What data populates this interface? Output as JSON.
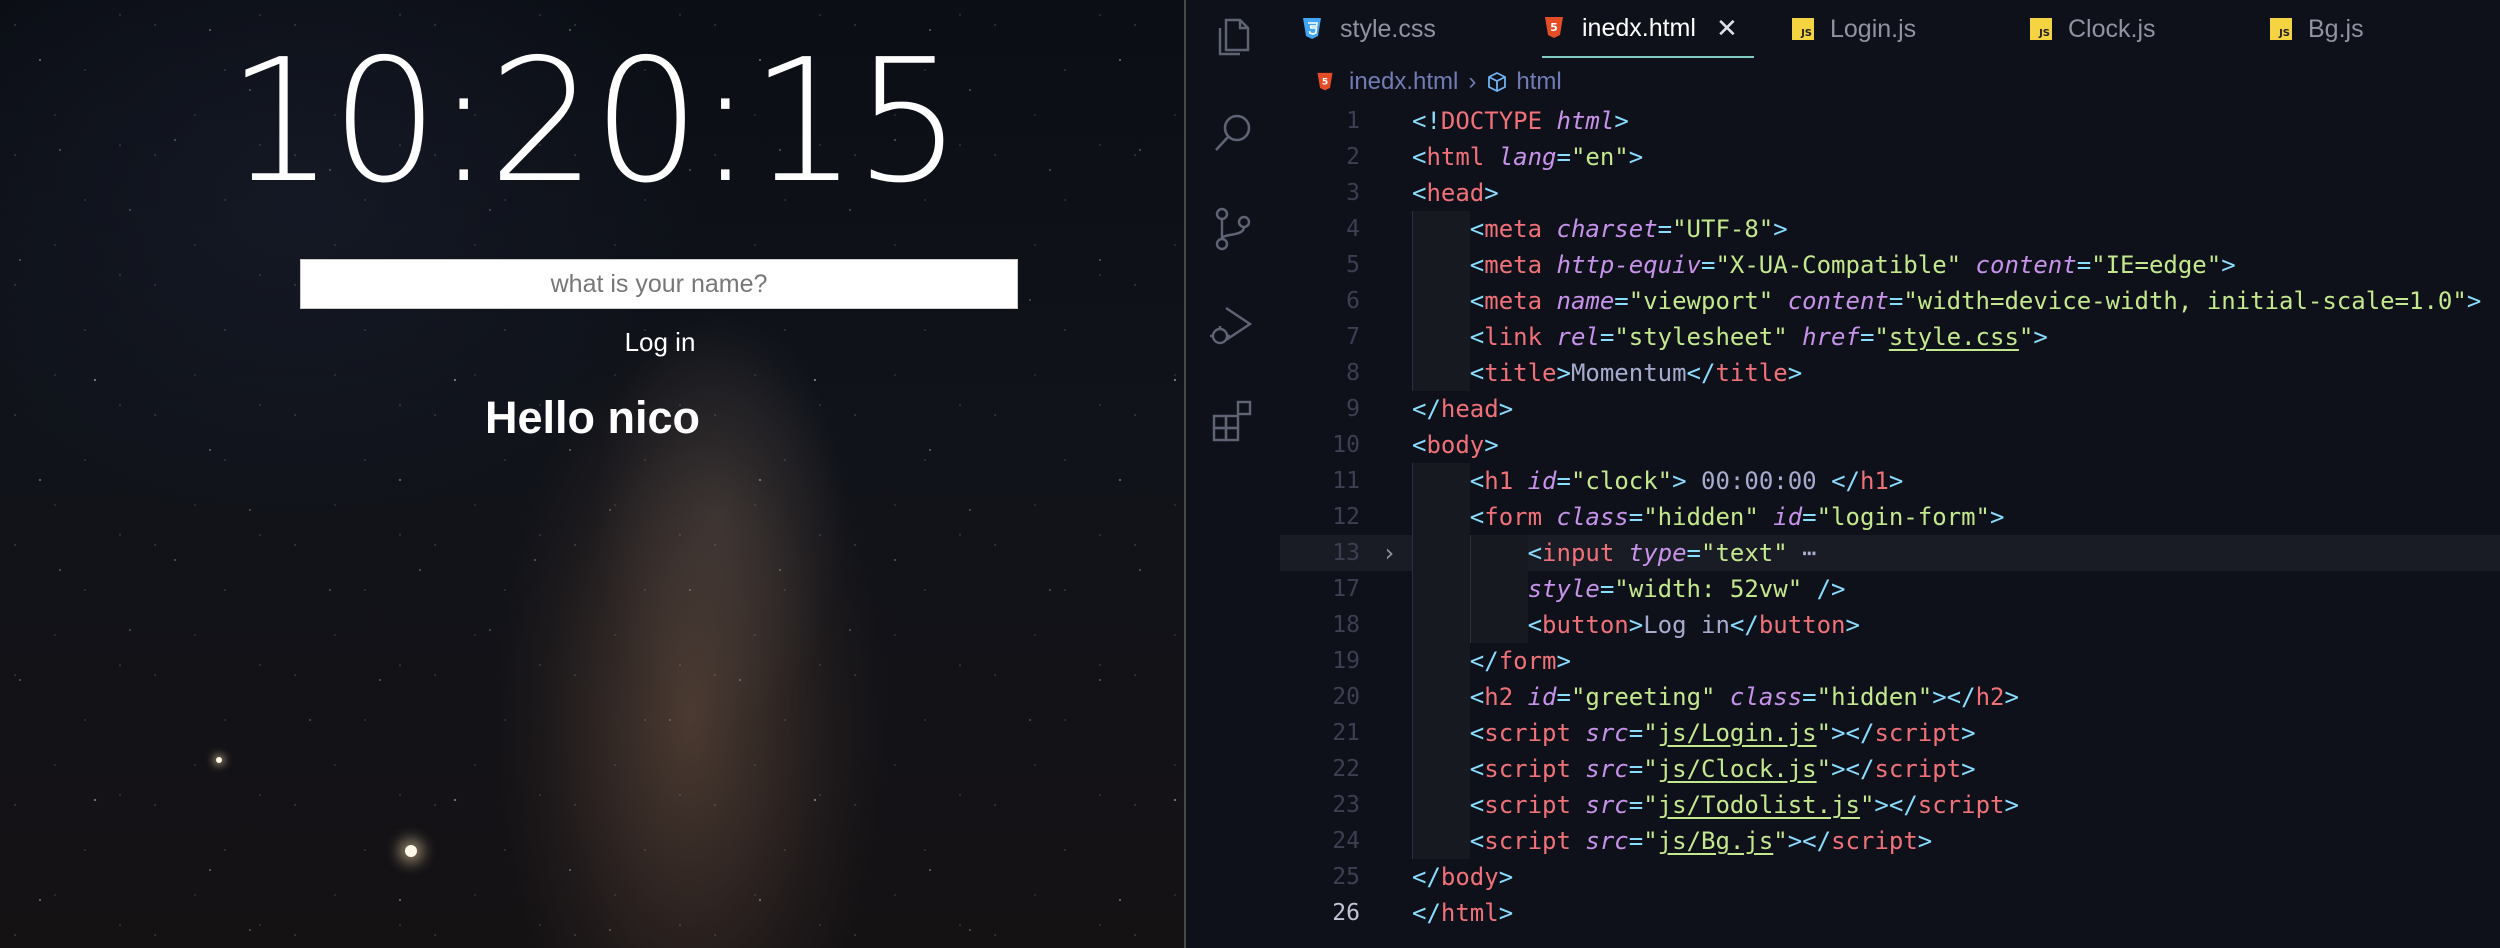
{
  "preview": {
    "clock": "10:20:15",
    "input_placeholder": "what is your name?",
    "login_button": "Log in",
    "greeting": "Hello nico"
  },
  "activity_bar": {
    "icons": [
      "files-icon",
      "search-icon",
      "source-control-icon",
      "run-debug-icon",
      "extensions-icon"
    ]
  },
  "tabs": [
    {
      "label": "style.css",
      "icon": "css-icon",
      "active": false
    },
    {
      "label": "inedx.html",
      "icon": "html-icon",
      "active": true
    },
    {
      "label": "Login.js",
      "icon": "js-icon",
      "active": false
    },
    {
      "label": "Clock.js",
      "icon": "js-icon",
      "active": false
    },
    {
      "label": "Bg.js",
      "icon": "js-icon",
      "active": false
    }
  ],
  "js_badge": "JS",
  "breadcrumb": {
    "file": "inedx.html",
    "symbol": "html"
  },
  "code": {
    "lines": [
      {
        "n": "1",
        "tokens": [
          [
            "br",
            "<!"
          ],
          [
            "tag",
            "DOCTYPE"
          ],
          [
            "txt",
            " "
          ],
          [
            "attr",
            "html"
          ],
          [
            "br",
            ">"
          ]
        ]
      },
      {
        "n": "2",
        "tokens": [
          [
            "br",
            "<"
          ],
          [
            "tag",
            "html"
          ],
          [
            "txt",
            " "
          ],
          [
            "attr",
            "lang"
          ],
          [
            "br",
            "="
          ],
          [
            "str",
            "\"en\""
          ],
          [
            "br",
            ">"
          ]
        ]
      },
      {
        "n": "3",
        "tokens": [
          [
            "br",
            "<"
          ],
          [
            "tag",
            "head"
          ],
          [
            "br",
            ">"
          ]
        ]
      },
      {
        "n": "4",
        "tokens": [
          [
            "br",
            "<"
          ],
          [
            "tag",
            "meta"
          ],
          [
            "txt",
            " "
          ],
          [
            "attr",
            "charset"
          ],
          [
            "br",
            "="
          ],
          [
            "str",
            "\"UTF-8\""
          ],
          [
            "br",
            ">"
          ]
        ]
      },
      {
        "n": "5",
        "tokens": [
          [
            "br",
            "<"
          ],
          [
            "tag",
            "meta"
          ],
          [
            "txt",
            " "
          ],
          [
            "attr",
            "http-equiv"
          ],
          [
            "br",
            "="
          ],
          [
            "str",
            "\"X-UA-Compatible\""
          ],
          [
            "txt",
            " "
          ],
          [
            "attr",
            "content"
          ],
          [
            "br",
            "="
          ],
          [
            "str",
            "\"IE=edge\""
          ],
          [
            "br",
            ">"
          ]
        ]
      },
      {
        "n": "6",
        "tokens": [
          [
            "br",
            "<"
          ],
          [
            "tag",
            "meta"
          ],
          [
            "txt",
            " "
          ],
          [
            "attr",
            "name"
          ],
          [
            "br",
            "="
          ],
          [
            "str",
            "\"viewport\""
          ],
          [
            "txt",
            " "
          ],
          [
            "attr",
            "content"
          ],
          [
            "br",
            "="
          ],
          [
            "str",
            "\"width=device-width, initial-scale=1.0\""
          ],
          [
            "br",
            ">"
          ]
        ]
      },
      {
        "n": "7",
        "tokens": [
          [
            "br",
            "<"
          ],
          [
            "tag",
            "link"
          ],
          [
            "txt",
            " "
          ],
          [
            "attr",
            "rel"
          ],
          [
            "br",
            "="
          ],
          [
            "str",
            "\"stylesheet\""
          ],
          [
            "txt",
            " "
          ],
          [
            "attr",
            "href"
          ],
          [
            "br",
            "="
          ],
          [
            "str",
            "\""
          ],
          [
            "stru",
            "style.css"
          ],
          [
            "str",
            "\""
          ],
          [
            "br",
            ">"
          ]
        ]
      },
      {
        "n": "8",
        "tokens": [
          [
            "br",
            "<"
          ],
          [
            "tag",
            "title"
          ],
          [
            "br",
            ">"
          ],
          [
            "txt",
            "Momentum"
          ],
          [
            "br",
            "</"
          ],
          [
            "tag",
            "title"
          ],
          [
            "br",
            ">"
          ]
        ]
      },
      {
        "n": "9",
        "tokens": [
          [
            "br",
            "</"
          ],
          [
            "tag",
            "head"
          ],
          [
            "br",
            ">"
          ]
        ]
      },
      {
        "n": "10",
        "tokens": [
          [
            "br",
            "<"
          ],
          [
            "tag",
            "body"
          ],
          [
            "br",
            ">"
          ]
        ]
      },
      {
        "n": "11",
        "tokens": [
          [
            "br",
            "<"
          ],
          [
            "tag",
            "h1"
          ],
          [
            "txt",
            " "
          ],
          [
            "attr",
            "id"
          ],
          [
            "br",
            "="
          ],
          [
            "str",
            "\"clock\""
          ],
          [
            "br",
            ">"
          ],
          [
            "txt",
            " 00:00:00 "
          ],
          [
            "br",
            "</"
          ],
          [
            "tag",
            "h1"
          ],
          [
            "br",
            ">"
          ]
        ]
      },
      {
        "n": "12",
        "tokens": [
          [
            "br",
            "<"
          ],
          [
            "tag",
            "form"
          ],
          [
            "txt",
            " "
          ],
          [
            "attr",
            "class"
          ],
          [
            "br",
            "="
          ],
          [
            "str",
            "\"hidden\""
          ],
          [
            "txt",
            " "
          ],
          [
            "attr",
            "id"
          ],
          [
            "br",
            "="
          ],
          [
            "str",
            "\"login-form\""
          ],
          [
            "br",
            ">"
          ]
        ]
      },
      {
        "n": "13",
        "tokens": [
          [
            "br",
            "<"
          ],
          [
            "tag",
            "input"
          ],
          [
            "txt",
            " "
          ],
          [
            "attr",
            "type"
          ],
          [
            "br",
            "="
          ],
          [
            "str",
            "\"text\""
          ],
          [
            "txt",
            " "
          ],
          [
            "dots",
            "⋯"
          ]
        ]
      },
      {
        "n": "17",
        "tokens": [
          [
            "attr",
            "style"
          ],
          [
            "br",
            "="
          ],
          [
            "str",
            "\"width: 52vw\""
          ],
          [
            "txt",
            " "
          ],
          [
            "br",
            "/>"
          ]
        ]
      },
      {
        "n": "18",
        "tokens": [
          [
            "br",
            "<"
          ],
          [
            "tag",
            "button"
          ],
          [
            "br",
            ">"
          ],
          [
            "txt",
            "Log in"
          ],
          [
            "br",
            "</"
          ],
          [
            "tag",
            "button"
          ],
          [
            "br",
            ">"
          ]
        ]
      },
      {
        "n": "19",
        "tokens": [
          [
            "br",
            "</"
          ],
          [
            "tag",
            "form"
          ],
          [
            "br",
            ">"
          ]
        ]
      },
      {
        "n": "20",
        "tokens": [
          [
            "br",
            "<"
          ],
          [
            "tag",
            "h2"
          ],
          [
            "txt",
            " "
          ],
          [
            "attr",
            "id"
          ],
          [
            "br",
            "="
          ],
          [
            "str",
            "\"greeting\""
          ],
          [
            "txt",
            " "
          ],
          [
            "attr",
            "class"
          ],
          [
            "br",
            "="
          ],
          [
            "str",
            "\"hidden\""
          ],
          [
            "br",
            "></"
          ],
          [
            "tag",
            "h2"
          ],
          [
            "br",
            ">"
          ]
        ]
      },
      {
        "n": "21",
        "tokens": [
          [
            "br",
            "<"
          ],
          [
            "tag",
            "script"
          ],
          [
            "txt",
            " "
          ],
          [
            "attr",
            "src"
          ],
          [
            "br",
            "="
          ],
          [
            "str",
            "\""
          ],
          [
            "stru",
            "js/Login.js"
          ],
          [
            "str",
            "\""
          ],
          [
            "br",
            "></"
          ],
          [
            "tag",
            "script"
          ],
          [
            "br",
            ">"
          ]
        ]
      },
      {
        "n": "22",
        "tokens": [
          [
            "br",
            "<"
          ],
          [
            "tag",
            "script"
          ],
          [
            "txt",
            " "
          ],
          [
            "attr",
            "src"
          ],
          [
            "br",
            "="
          ],
          [
            "str",
            "\""
          ],
          [
            "stru",
            "js/Clock.js"
          ],
          [
            "str",
            "\""
          ],
          [
            "br",
            "></"
          ],
          [
            "tag",
            "script"
          ],
          [
            "br",
            ">"
          ]
        ]
      },
      {
        "n": "23",
        "tokens": [
          [
            "br",
            "<"
          ],
          [
            "tag",
            "script"
          ],
          [
            "txt",
            " "
          ],
          [
            "attr",
            "src"
          ],
          [
            "br",
            "="
          ],
          [
            "str",
            "\""
          ],
          [
            "stru",
            "js/Todolist.js"
          ],
          [
            "str",
            "\""
          ],
          [
            "br",
            "></"
          ],
          [
            "tag",
            "script"
          ],
          [
            "br",
            ">"
          ]
        ]
      },
      {
        "n": "24",
        "tokens": [
          [
            "br",
            "<"
          ],
          [
            "tag",
            "script"
          ],
          [
            "txt",
            " "
          ],
          [
            "attr",
            "src"
          ],
          [
            "br",
            "="
          ],
          [
            "str",
            "\""
          ],
          [
            "stru",
            "js/Bg.js"
          ],
          [
            "str",
            "\""
          ],
          [
            "br",
            "></"
          ],
          [
            "tag",
            "script"
          ],
          [
            "br",
            ">"
          ]
        ]
      },
      {
        "n": "25",
        "tokens": [
          [
            "br",
            "</"
          ],
          [
            "tag",
            "body"
          ],
          [
            "br",
            ">"
          ]
        ]
      },
      {
        "n": "26",
        "tokens": [
          [
            "br",
            "</"
          ],
          [
            "tag",
            "html"
          ],
          [
            "br",
            ">"
          ]
        ]
      }
    ]
  },
  "colors": {
    "editor_bg": "#0f111a",
    "tag": "#f07178",
    "attr": "#c792ea",
    "string": "#c3e88d",
    "bracket": "#89ddff",
    "text": "#a6accd",
    "active_tab_border": "#80cbc4",
    "html_icon": "#e44d26",
    "css_icon": "#42a5f5",
    "js_icon": "#f5d442"
  }
}
